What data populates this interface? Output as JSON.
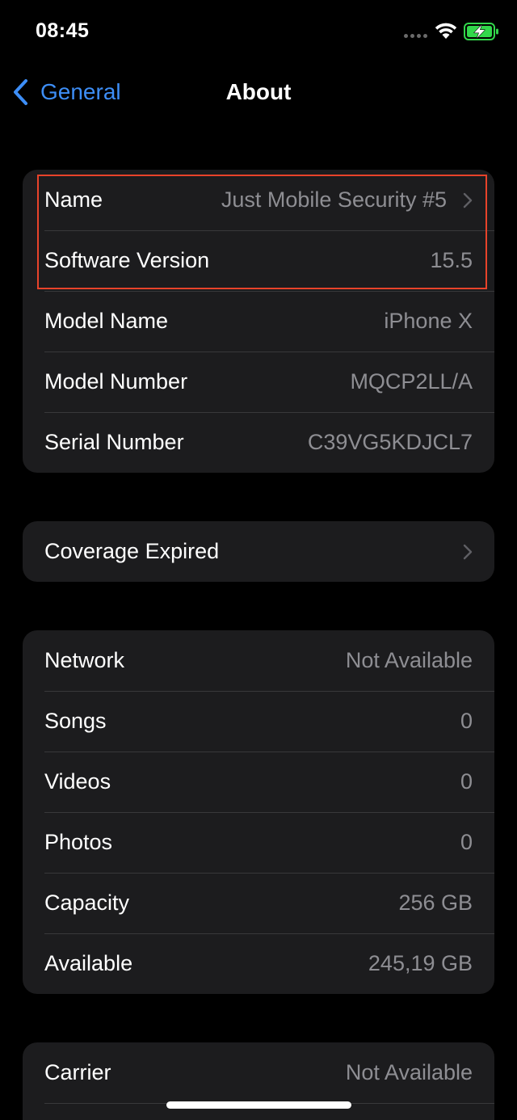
{
  "status_bar": {
    "time": "08:45",
    "wifi_icon": "wifi-icon",
    "battery_icon": "battery-charging-icon",
    "battery_color": "#32d74b"
  },
  "nav": {
    "back_label": "General",
    "title": "About",
    "accent_color": "#3d8ef7"
  },
  "groups": {
    "device_info": [
      {
        "label": "Name",
        "value": "Just Mobile Security #5",
        "chevron": true
      },
      {
        "label": "Software Version",
        "value": "15.5"
      },
      {
        "label": "Model Name",
        "value": "iPhone X"
      },
      {
        "label": "Model Number",
        "value": "MQCP2LL/A"
      },
      {
        "label": "Serial Number",
        "value": "C39VG5KDJCL7"
      }
    ],
    "coverage": [
      {
        "label": "Coverage Expired",
        "chevron": true
      }
    ],
    "media": [
      {
        "label": "Network",
        "value": "Not Available"
      },
      {
        "label": "Songs",
        "value": "0"
      },
      {
        "label": "Videos",
        "value": "0"
      },
      {
        "label": "Photos",
        "value": "0"
      },
      {
        "label": "Capacity",
        "value": "256 GB"
      },
      {
        "label": "Available",
        "value": "245,19 GB"
      }
    ],
    "carrier": [
      {
        "label": "Carrier",
        "value": "Not Available"
      }
    ]
  },
  "highlight_color": "#e8432a"
}
